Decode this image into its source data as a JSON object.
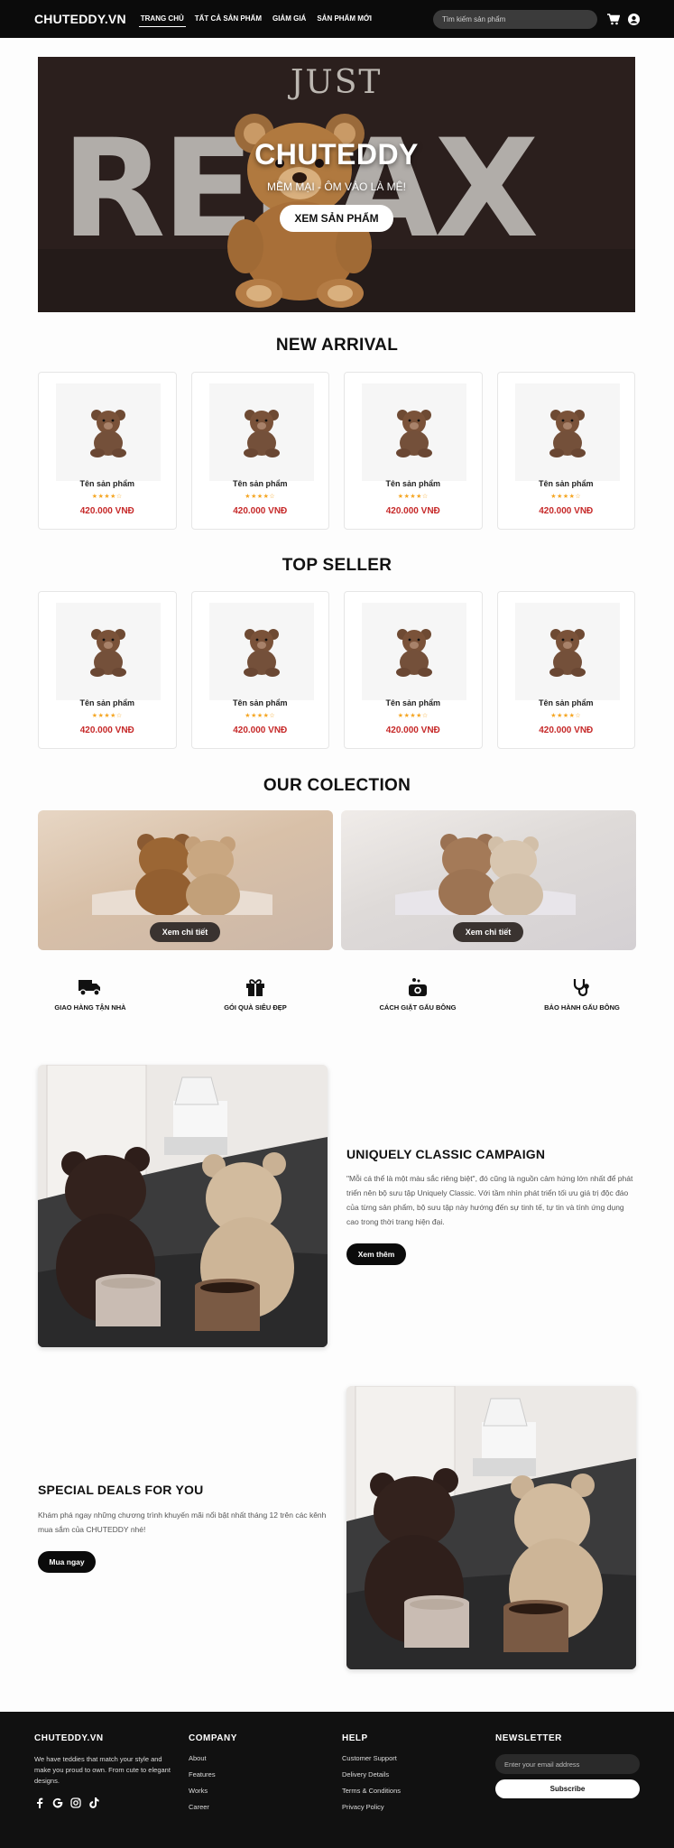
{
  "header": {
    "logo": "CHUTEDDY.VN",
    "nav": [
      "TRANG CHỦ",
      "TẤT CẢ SẢN PHẨM",
      "GIẢM GIÁ",
      "SẢN PHẨM MỚI"
    ],
    "search_placeholder": "Tìm kiếm sản phẩm",
    "icons": [
      "cart-icon",
      "user-icon"
    ]
  },
  "hero": {
    "bg_word": "RELAX",
    "small_word": "JUST",
    "title": "CHUTEDDY",
    "subtitle": "MỀM MẠI - ÔM VÀO LÀ MÊ!",
    "cta": "XEM SẢN PHẨM"
  },
  "new_arrival": {
    "title": "NEW ARRIVAL",
    "products": [
      {
        "name": "Tên sản phẩm",
        "stars": "★★★★☆",
        "price": "420.000 VNĐ"
      },
      {
        "name": "Tên sản phẩm",
        "stars": "★★★★☆",
        "price": "420.000 VNĐ"
      },
      {
        "name": "Tên sản phẩm",
        "stars": "★★★★☆",
        "price": "420.000 VNĐ"
      },
      {
        "name": "Tên sản phẩm",
        "stars": "★★★★☆",
        "price": "420.000 VNĐ"
      }
    ]
  },
  "top_seller": {
    "title": "TOP SELLER",
    "products": [
      {
        "name": "Tên sản phẩm",
        "stars": "★★★★☆",
        "price": "420.000 VNĐ"
      },
      {
        "name": "Tên sản phẩm",
        "stars": "★★★★☆",
        "price": "420.000 VNĐ"
      },
      {
        "name": "Tên sản phẩm",
        "stars": "★★★★☆",
        "price": "420.000 VNĐ"
      },
      {
        "name": "Tên sản phẩm",
        "stars": "★★★★☆",
        "price": "420.000 VNĐ"
      }
    ]
  },
  "collection": {
    "title": "OUR COLECTION",
    "items": [
      {
        "button": "Xem chi tiết"
      },
      {
        "button": "Xem chi tiết"
      }
    ]
  },
  "features": [
    {
      "icon": "truck-icon",
      "label": "GIAO HÀNG TẬN NHÀ"
    },
    {
      "icon": "gift-icon",
      "label": "GÓI QUÀ SIÊU ĐẸP"
    },
    {
      "icon": "washer-icon",
      "label": "CÁCH GIẶT GẤU BÔNG"
    },
    {
      "icon": "stethoscope-icon",
      "label": "BẢO HÀNH GẤU BÔNG"
    }
  ],
  "campaign": {
    "title": "UNIQUELY CLASSIC CAMPAIGN",
    "body": "\"Mỗi cá thể là một màu sắc riêng biệt\", đó cũng là nguồn cảm hứng lớn nhất để phát triển nên bộ sưu tập Uniquely Classic. Với tầm nhìn phát triển tối ưu giá trị độc đáo của từng sản phẩm, bộ sưu tập này hướng đến sự tinh tế, tự tin và tính ứng dụng cao trong thời trang hiện đại.",
    "button": "Xem thêm"
  },
  "deals": {
    "title": "SPECIAL DEALS FOR YOU",
    "body": "Khám phá ngay những chương trình khuyến mãi nổi bật nhất tháng 12 trên các kênh mua sắm của CHUTEDDY nhé!",
    "button": "Mua ngay"
  },
  "footer": {
    "brand": "CHUTEDDY.VN",
    "desc": "We have teddies that match your style and make you proud to own. From cute to elegant designs.",
    "socials": [
      "facebook-icon",
      "google-icon",
      "instagram-icon",
      "tiktok-icon"
    ],
    "company": {
      "title": "COMPANY",
      "links": [
        "About",
        "Features",
        "Works",
        "Career"
      ]
    },
    "help": {
      "title": "HELP",
      "links": [
        "Customer Support",
        "Delivery Details",
        "Terms & Conditions",
        "Privacy Policy"
      ]
    },
    "newsletter": {
      "title": "NEWSLETTER",
      "placeholder": "Enter your email address",
      "button": "Subscribe"
    }
  },
  "colors": {
    "header_bg": "#0b0b0b",
    "price": "#c62828",
    "stars": "#f5a623",
    "footer_bg": "#111111"
  }
}
